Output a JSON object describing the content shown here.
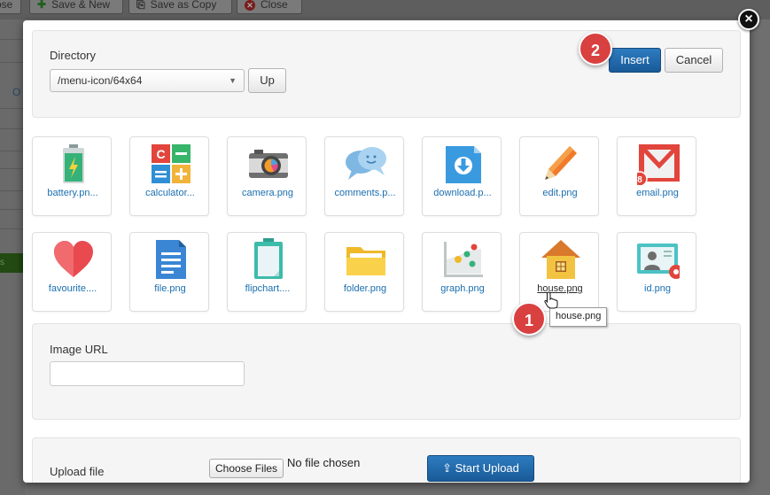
{
  "background": {
    "toolbar": {
      "close_partial": "ose",
      "save_new": "Save & New",
      "save_copy": "Save as Copy",
      "close": "Close"
    },
    "left_letter": "O",
    "left_green": "s"
  },
  "directory": {
    "label": "Directory",
    "selected": "/menu-icon/64x64",
    "up_label": "Up"
  },
  "actions": {
    "insert_label": "Insert",
    "cancel_label": "Cancel"
  },
  "images": [
    {
      "name": "battery.pn...",
      "icon": "battery-icon"
    },
    {
      "name": "calculator...",
      "icon": "calculator-icon"
    },
    {
      "name": "camera.png",
      "icon": "camera-icon"
    },
    {
      "name": "comments.p...",
      "icon": "comments-icon"
    },
    {
      "name": "download.p...",
      "icon": "download-icon"
    },
    {
      "name": "edit.png",
      "icon": "pencil-icon"
    },
    {
      "name": "email.png",
      "icon": "email-icon"
    },
    {
      "name": "favourite....",
      "icon": "heart-icon"
    },
    {
      "name": "file.png",
      "icon": "file-icon"
    },
    {
      "name": "flipchart....",
      "icon": "flipchart-icon"
    },
    {
      "name": "folder.png",
      "icon": "folder-icon"
    },
    {
      "name": "graph.png",
      "icon": "graph-icon"
    },
    {
      "name": "house.png",
      "icon": "house-icon"
    },
    {
      "name": "id.png",
      "icon": "id-card-icon"
    }
  ],
  "email_badge": "8",
  "tooltip": "house.png",
  "markers": {
    "one": "1",
    "two": "2"
  },
  "image_url": {
    "label": "Image URL",
    "value": ""
  },
  "upload": {
    "label": "Upload file",
    "choose_label": "Choose Files",
    "no_file": "No file chosen",
    "start_label": "Start Upload"
  },
  "colors": {
    "primary": "#1f65a8",
    "link": "#1a6fb0",
    "marker": "#d94040"
  }
}
